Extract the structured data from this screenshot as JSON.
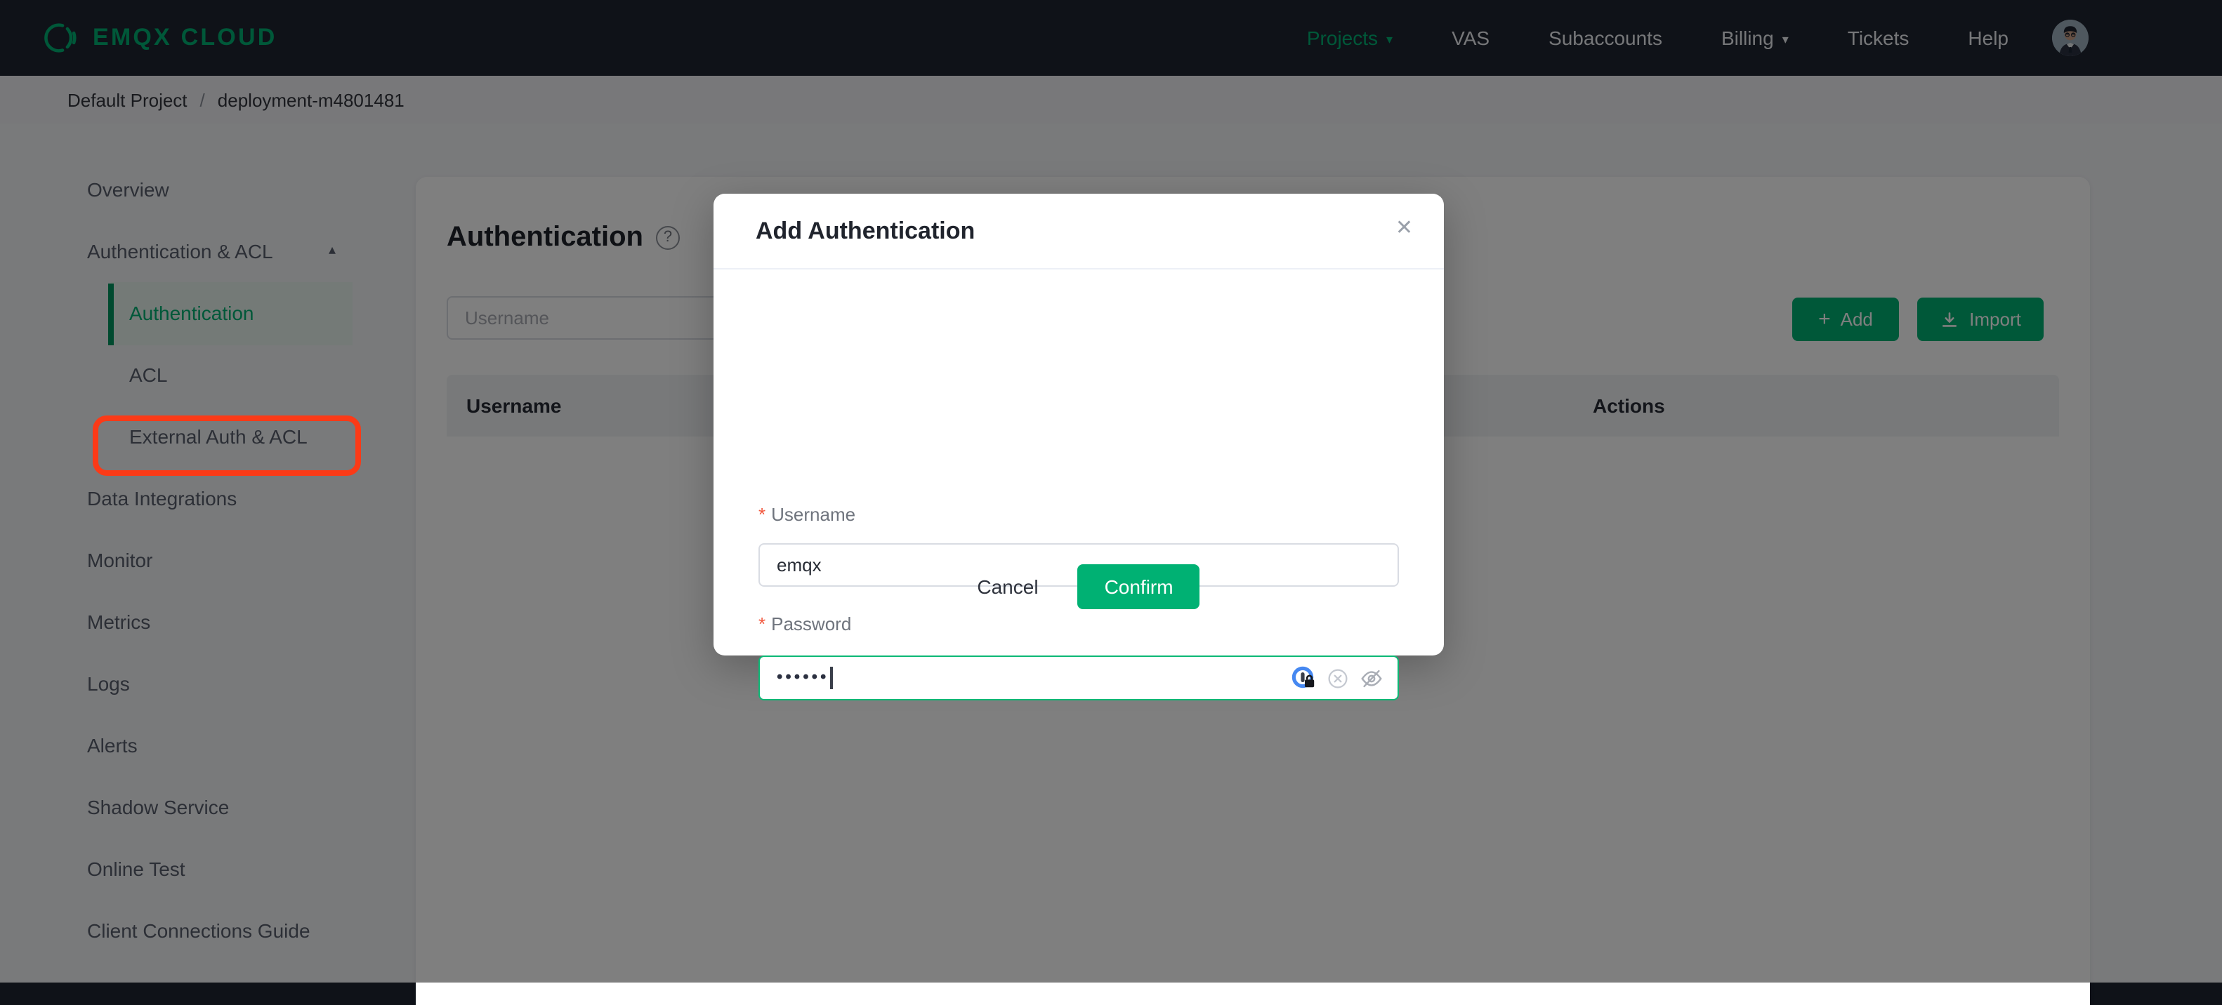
{
  "navbar": {
    "brand": "EMQX CLOUD",
    "items": [
      {
        "label": "Projects"
      },
      {
        "label": "VAS"
      },
      {
        "label": "Subaccounts"
      },
      {
        "label": "Billing"
      },
      {
        "label": "Tickets"
      },
      {
        "label": "Help"
      }
    ],
    "caret": "▾",
    "accent_color": "#00b173"
  },
  "breadcrumb": {
    "project": "Default Project",
    "separator": "/",
    "deployment": "deployment-m4801481"
  },
  "sidebar": {
    "overview": "Overview",
    "group_label": "Authentication & ACL",
    "collapse_icon": "▴",
    "sub_items": [
      "Authentication",
      "ACL",
      "External Auth & ACL"
    ],
    "active_sub_item": "Authentication",
    "items": [
      "Data Integrations",
      "Monitor",
      "Metrics",
      "Logs",
      "Alerts",
      "Shadow Service",
      "Online Test",
      "Client Connections Guide"
    ]
  },
  "content": {
    "title": "Authentication",
    "help_icon": "?",
    "filter_placeholder": "Username",
    "add_icon": "+",
    "add_button": "Add",
    "import_button": "Import",
    "table": {
      "columns": [
        "Username",
        "Actions"
      ]
    }
  },
  "modal": {
    "title": "Add Authentication",
    "close_icon": "✕",
    "required_marker": "*",
    "username_label": "Username",
    "username_value": "emqx",
    "password_label": "Password",
    "password_masked_value": "••••••",
    "cancel_button": "Cancel",
    "confirm_button": "Confirm",
    "accent_color": "#00b173"
  },
  "annotation": {
    "color": "#fb3a17",
    "target": "Authentication sidebar item"
  }
}
